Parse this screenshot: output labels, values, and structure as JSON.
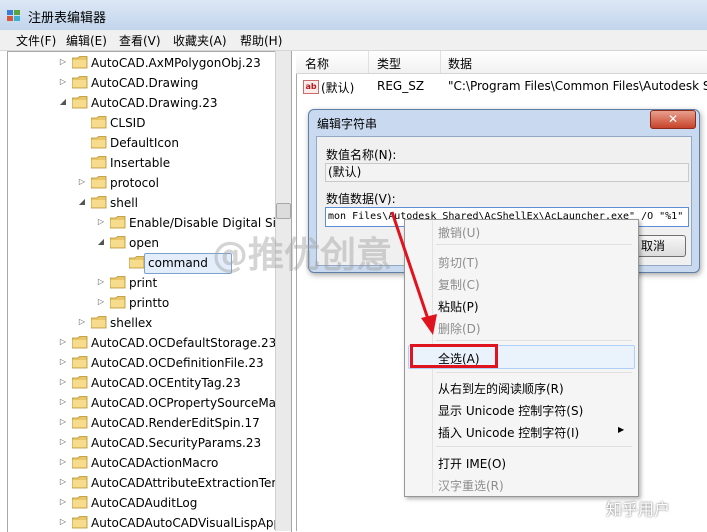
{
  "window": {
    "title": "注册表编辑器",
    "icon": "registry-editor-icon"
  },
  "menubar": [
    "文件(F)",
    "编辑(E)",
    "查看(V)",
    "收藏夹(A)",
    "帮助(H)"
  ],
  "tree": [
    {
      "label": "AutoCAD.AxMPolygonObj.23",
      "indent": 0,
      "exp": "collapsed"
    },
    {
      "label": "AutoCAD.Drawing",
      "indent": 0,
      "exp": "collapsed"
    },
    {
      "label": "AutoCAD.Drawing.23",
      "indent": 0,
      "exp": "expanded"
    },
    {
      "label": "CLSID",
      "indent": 1,
      "exp": "none"
    },
    {
      "label": "DefaultIcon",
      "indent": 1,
      "exp": "none"
    },
    {
      "label": "Insertable",
      "indent": 1,
      "exp": "none"
    },
    {
      "label": "protocol",
      "indent": 1,
      "exp": "collapsed"
    },
    {
      "label": "shell",
      "indent": 1,
      "exp": "expanded"
    },
    {
      "label": "Enable/Disable Digital Signature",
      "indent": 2,
      "exp": "collapsed"
    },
    {
      "label": "open",
      "indent": 2,
      "exp": "expanded"
    },
    {
      "label": "command",
      "indent": 3,
      "exp": "none",
      "selected": true
    },
    {
      "label": "print",
      "indent": 2,
      "exp": "collapsed"
    },
    {
      "label": "printto",
      "indent": 2,
      "exp": "collapsed"
    },
    {
      "label": "shellex",
      "indent": 1,
      "exp": "collapsed"
    },
    {
      "label": "AutoCAD.OCDefaultStorage.23",
      "indent": 0,
      "exp": "collapsed"
    },
    {
      "label": "AutoCAD.OCDefinitionFile.23",
      "indent": 0,
      "exp": "collapsed"
    },
    {
      "label": "AutoCAD.OCEntityTag.23",
      "indent": 0,
      "exp": "collapsed"
    },
    {
      "label": "AutoCAD.OCPropertySourceManager",
      "indent": 0,
      "exp": "collapsed"
    },
    {
      "label": "AutoCAD.RenderEditSpin.17",
      "indent": 0,
      "exp": "collapsed"
    },
    {
      "label": "AutoCAD.SecurityParams.23",
      "indent": 0,
      "exp": "collapsed"
    },
    {
      "label": "AutoCADActionMacro",
      "indent": 0,
      "exp": "collapsed"
    },
    {
      "label": "AutoCADAttributeExtractionTemplate",
      "indent": 0,
      "exp": "collapsed"
    },
    {
      "label": "AutoCADAuditLog",
      "indent": 0,
      "exp": "collapsed"
    },
    {
      "label": "AutoCADAutoCADVisualLispApp",
      "indent": 0,
      "exp": "collapsed"
    }
  ],
  "list": {
    "columns": [
      "名称",
      "类型",
      "数据"
    ],
    "row": {
      "name": "(默认)",
      "type": "REG_SZ",
      "data": "\"C:\\Program Files\\Common Files\\Autodesk S"
    }
  },
  "dialog": {
    "title": "编辑字符串",
    "close": "✕",
    "name_label": "数值名称(N):",
    "name_value": "(默认)",
    "data_label": "数值数据(V):",
    "data_value": "mon Files\\Autodesk Shared\\AcShellEx\\AcLauncher.exe\" /O \"%1\"",
    "cancel": "取消"
  },
  "context_menu": {
    "undo": "撤销(U)",
    "cut": "剪切(T)",
    "copy": "复制(C)",
    "paste": "粘贴(P)",
    "delete": "删除(D)",
    "select_all": "全选(A)",
    "rtl": "从右到左的阅读顺序(R)",
    "show_unicode": "显示 Unicode 控制字符(S)",
    "insert_unicode": "插入 Unicode 控制字符(I)",
    "open_ime": "打开 IME(O)",
    "reconvert": "汉字重选(R)"
  },
  "watermarks": {
    "center": "@推优创意",
    "corner": "知乎用户"
  },
  "colors": {
    "highlight_red": "#e0141e",
    "dialog_frame": "#c9daf0",
    "folder": "#e8c66a"
  }
}
